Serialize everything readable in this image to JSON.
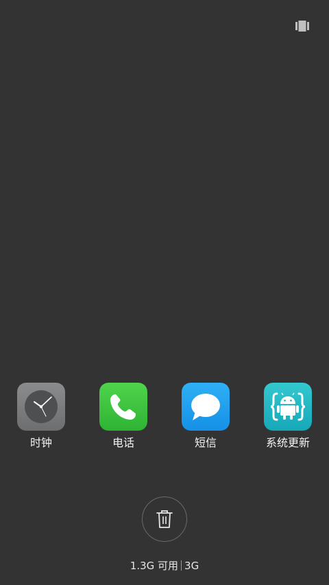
{
  "top_bar": {
    "toggle_icon": "card-view-icon"
  },
  "apps": [
    {
      "label": "时钟",
      "icon": "clock-icon",
      "color": "#7a7c7e"
    },
    {
      "label": "电话",
      "icon": "phone-icon",
      "color": "#3ec43f"
    },
    {
      "label": "短信",
      "icon": "message-icon",
      "color": "#1e9ff0"
    },
    {
      "label": "系统更新",
      "icon": "android-update-icon",
      "color": "#22b6c3"
    }
  ],
  "clear_button": {
    "icon": "trash-icon"
  },
  "memory": {
    "available": "1.3G 可用",
    "total": "3G"
  }
}
